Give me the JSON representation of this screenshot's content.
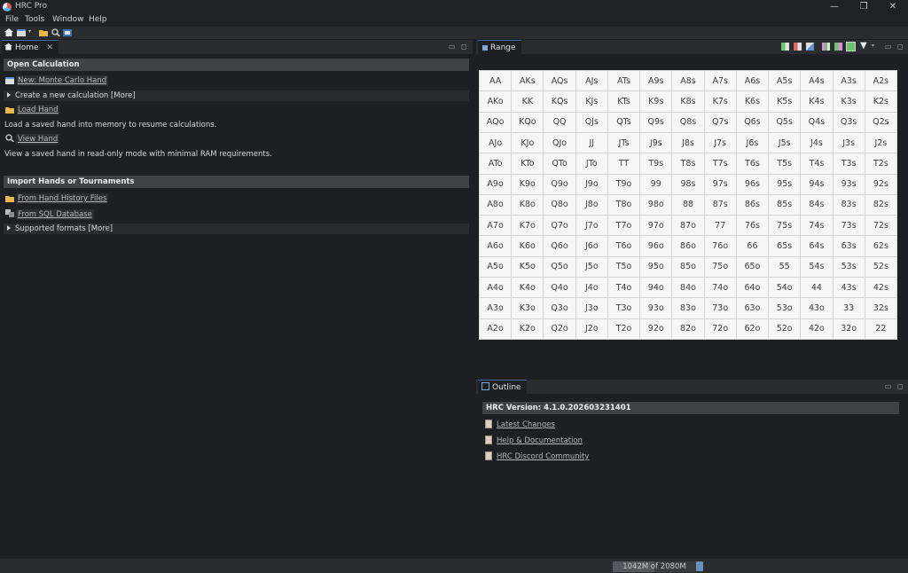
{
  "window": {
    "title": "HRC Pro",
    "controls": [
      "—",
      "❐",
      "✕"
    ]
  },
  "menu": [
    "File",
    "Tools",
    "Window",
    "Help"
  ],
  "home": {
    "tab_label": "Home",
    "open_calc": {
      "heading": "Open Calculation",
      "new_hand": "New: Monte Carlo Hand",
      "create_more": "Create a new calculation [More]",
      "load_hand": "Load Hand",
      "load_desc": "Load a saved hand into memory to resume calculations.",
      "view_hand": "View Hand",
      "view_desc": "View a saved hand in read-only mode with minimal RAM requirements."
    },
    "import": {
      "heading": "Import Hands or Tournaments",
      "from_history": "From Hand History Files",
      "from_sql": "From SQL Database",
      "supported": "Supported formats [More]"
    }
  },
  "range": {
    "tab_label": "Range",
    "hands": [
      [
        "AA",
        "AKs",
        "AQs",
        "AJs",
        "ATs",
        "A9s",
        "A8s",
        "A7s",
        "A6s",
        "A5s",
        "A4s",
        "A3s",
        "A2s"
      ],
      [
        "AKo",
        "KK",
        "KQs",
        "KJs",
        "KTs",
        "K9s",
        "K8s",
        "K7s",
        "K6s",
        "K5s",
        "K4s",
        "K3s",
        "K2s"
      ],
      [
        "AQo",
        "KQo",
        "QQ",
        "QJs",
        "QTs",
        "Q9s",
        "Q8s",
        "Q7s",
        "Q6s",
        "Q5s",
        "Q4s",
        "Q3s",
        "Q2s"
      ],
      [
        "AJo",
        "KJo",
        "QJo",
        "JJ",
        "JTs",
        "J9s",
        "J8s",
        "J7s",
        "J6s",
        "J5s",
        "J4s",
        "J3s",
        "J2s"
      ],
      [
        "ATo",
        "KTo",
        "QTo",
        "JTo",
        "TT",
        "T9s",
        "T8s",
        "T7s",
        "T6s",
        "T5s",
        "T4s",
        "T3s",
        "T2s"
      ],
      [
        "A9o",
        "K9o",
        "Q9o",
        "J9o",
        "T9o",
        "99",
        "98s",
        "97s",
        "96s",
        "95s",
        "94s",
        "93s",
        "92s"
      ],
      [
        "A8o",
        "K8o",
        "Q8o",
        "J8o",
        "T8o",
        "98o",
        "88",
        "87s",
        "86s",
        "85s",
        "84s",
        "83s",
        "82s"
      ],
      [
        "A7o",
        "K7o",
        "Q7o",
        "J7o",
        "T7o",
        "97o",
        "87o",
        "77",
        "76s",
        "75s",
        "74s",
        "73s",
        "72s"
      ],
      [
        "A6o",
        "K6o",
        "Q6o",
        "J6o",
        "T6o",
        "96o",
        "86o",
        "76o",
        "66",
        "65s",
        "64s",
        "63s",
        "62s"
      ],
      [
        "A5o",
        "K5o",
        "Q5o",
        "J5o",
        "T5o",
        "95o",
        "85o",
        "75o",
        "65o",
        "55",
        "54s",
        "53s",
        "52s"
      ],
      [
        "A4o",
        "K4o",
        "Q4o",
        "J4o",
        "T4o",
        "94o",
        "84o",
        "74o",
        "64o",
        "54o",
        "44",
        "43s",
        "42s"
      ],
      [
        "A3o",
        "K3o",
        "Q3o",
        "J3o",
        "T3o",
        "93o",
        "83o",
        "73o",
        "63o",
        "53o",
        "43o",
        "33",
        "32s"
      ],
      [
        "A2o",
        "K2o",
        "Q2o",
        "J2o",
        "T2o",
        "92o",
        "82o",
        "72o",
        "62o",
        "52o",
        "42o",
        "32o",
        "22"
      ]
    ]
  },
  "outline": {
    "tab_label": "Outline",
    "version": "HRC Version: 4.1.0.202603231401",
    "links": [
      "Latest Changes",
      "Help & Documentation",
      "HRC Discord Community"
    ]
  },
  "status": {
    "memory": "1042M of 2080M",
    "memory_fraction": 0.5
  },
  "colors": {
    "accent": "#4a6b9a",
    "panel": "#1e1f22",
    "header": "#404246"
  }
}
